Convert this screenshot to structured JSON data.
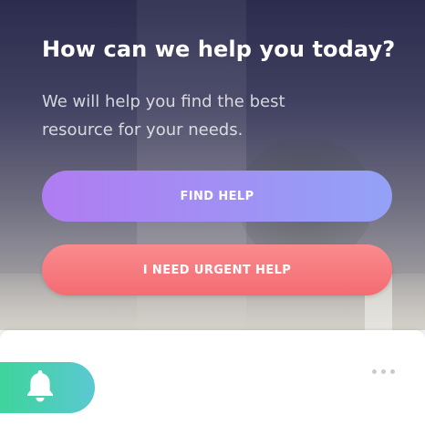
{
  "hero": {
    "title": "How can we help you today?",
    "subtitle": "We will help you find the best resource for your needs."
  },
  "actions": {
    "find_help_label": "FIND HELP",
    "urgent_help_label": "I NEED URGENT HELP"
  },
  "card": {
    "bell_icon": "bell-icon",
    "more_icon": "more-horizontal-icon"
  },
  "colors": {
    "find_help_gradient": [
      "#b07cf2",
      "#93a2f6"
    ],
    "urgent_gradient": [
      "#f98b8e",
      "#f46c72"
    ],
    "bell_gradient": [
      "#3ed49b",
      "#5bc8d2"
    ]
  }
}
